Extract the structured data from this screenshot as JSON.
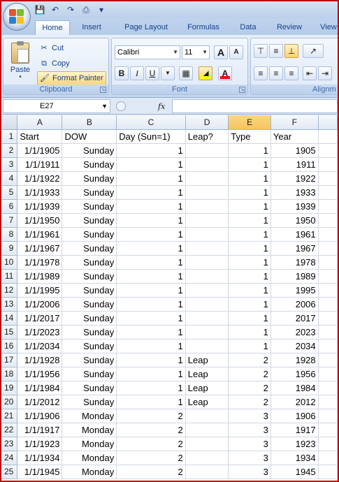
{
  "quick_access": {
    "icons": [
      "save-icon",
      "undo-icon",
      "redo-icon",
      "print-preview-icon",
      "customize-qat-icon"
    ]
  },
  "tabs": [
    {
      "label": "Home",
      "active": true
    },
    {
      "label": "Insert"
    },
    {
      "label": "Page Layout"
    },
    {
      "label": "Formulas"
    },
    {
      "label": "Data"
    },
    {
      "label": "Review"
    },
    {
      "label": "View"
    }
  ],
  "ribbon": {
    "clipboard": {
      "label": "Clipboard",
      "paste": "Paste",
      "cut": "Cut",
      "copy": "Copy",
      "format_painter": "Format Painter"
    },
    "font": {
      "label": "Font",
      "font_name": "Calibri",
      "font_size": "11",
      "bold": "B",
      "italic": "I",
      "underline": "U",
      "grow": "A",
      "shrink": "A",
      "font_color_letter": "A",
      "fill_color": "#ffff00",
      "font_color": "#ff0000"
    },
    "alignment": {
      "label": "Alignm"
    }
  },
  "formula_bar": {
    "name_box": "E27",
    "fx": "fx",
    "content": ""
  },
  "sheet": {
    "selected_column": "E",
    "columns": [
      "A",
      "B",
      "C",
      "D",
      "E",
      "F"
    ],
    "rows": [
      {
        "n": "1",
        "cells": [
          "Start",
          "DOW",
          "Day (Sun=1)",
          "Leap?",
          "Type",
          "Year"
        ]
      },
      {
        "n": "2",
        "cells": [
          "1/1/1905",
          "Sunday",
          "1",
          "",
          "1",
          "1905"
        ]
      },
      {
        "n": "3",
        "cells": [
          "1/1/1911",
          "Sunday",
          "1",
          "",
          "1",
          "1911"
        ]
      },
      {
        "n": "4",
        "cells": [
          "1/1/1922",
          "Sunday",
          "1",
          "",
          "1",
          "1922"
        ]
      },
      {
        "n": "5",
        "cells": [
          "1/1/1933",
          "Sunday",
          "1",
          "",
          "1",
          "1933"
        ]
      },
      {
        "n": "6",
        "cells": [
          "1/1/1939",
          "Sunday",
          "1",
          "",
          "1",
          "1939"
        ]
      },
      {
        "n": "7",
        "cells": [
          "1/1/1950",
          "Sunday",
          "1",
          "",
          "1",
          "1950"
        ]
      },
      {
        "n": "8",
        "cells": [
          "1/1/1961",
          "Sunday",
          "1",
          "",
          "1",
          "1961"
        ]
      },
      {
        "n": "9",
        "cells": [
          "1/1/1967",
          "Sunday",
          "1",
          "",
          "1",
          "1967"
        ]
      },
      {
        "n": "10",
        "cells": [
          "1/1/1978",
          "Sunday",
          "1",
          "",
          "1",
          "1978"
        ]
      },
      {
        "n": "11",
        "cells": [
          "1/1/1989",
          "Sunday",
          "1",
          "",
          "1",
          "1989"
        ]
      },
      {
        "n": "12",
        "cells": [
          "1/1/1995",
          "Sunday",
          "1",
          "",
          "1",
          "1995"
        ]
      },
      {
        "n": "13",
        "cells": [
          "1/1/2006",
          "Sunday",
          "1",
          "",
          "1",
          "2006"
        ]
      },
      {
        "n": "14",
        "cells": [
          "1/1/2017",
          "Sunday",
          "1",
          "",
          "1",
          "2017"
        ]
      },
      {
        "n": "15",
        "cells": [
          "1/1/2023",
          "Sunday",
          "1",
          "",
          "1",
          "2023"
        ]
      },
      {
        "n": "16",
        "cells": [
          "1/1/2034",
          "Sunday",
          "1",
          "",
          "1",
          "2034"
        ]
      },
      {
        "n": "17",
        "cells": [
          "1/1/1928",
          "Sunday",
          "1",
          "Leap",
          "2",
          "1928"
        ]
      },
      {
        "n": "18",
        "cells": [
          "1/1/1956",
          "Sunday",
          "1",
          "Leap",
          "2",
          "1956"
        ]
      },
      {
        "n": "19",
        "cells": [
          "1/1/1984",
          "Sunday",
          "1",
          "Leap",
          "2",
          "1984"
        ]
      },
      {
        "n": "20",
        "cells": [
          "1/1/2012",
          "Sunday",
          "1",
          "Leap",
          "2",
          "2012"
        ]
      },
      {
        "n": "21",
        "cells": [
          "1/1/1906",
          "Monday",
          "2",
          "",
          "3",
          "1906"
        ]
      },
      {
        "n": "22",
        "cells": [
          "1/1/1917",
          "Monday",
          "2",
          "",
          "3",
          "1917"
        ]
      },
      {
        "n": "23",
        "cells": [
          "1/1/1923",
          "Monday",
          "2",
          "",
          "3",
          "1923"
        ]
      },
      {
        "n": "24",
        "cells": [
          "1/1/1934",
          "Monday",
          "2",
          "",
          "3",
          "1934"
        ]
      },
      {
        "n": "25",
        "cells": [
          "1/1/1945",
          "Monday",
          "2",
          "",
          "3",
          "1945"
        ]
      }
    ]
  }
}
